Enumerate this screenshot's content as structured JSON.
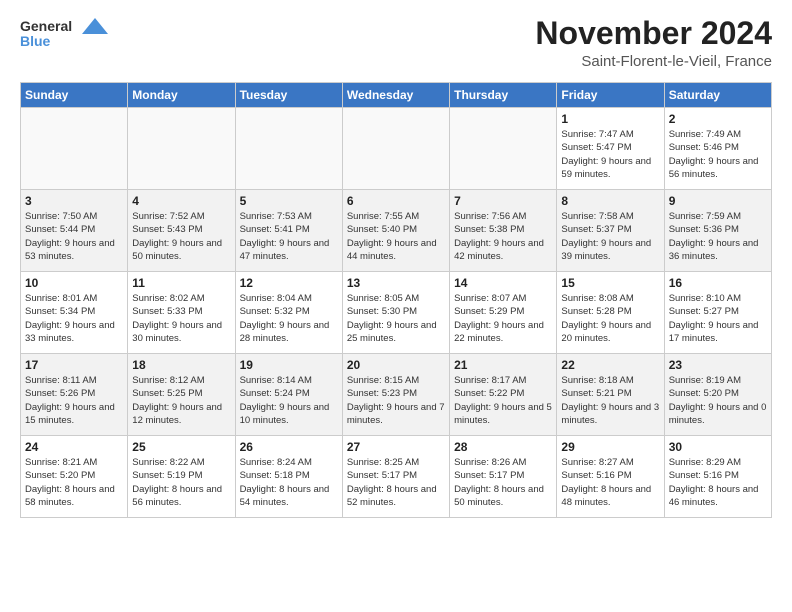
{
  "logo": {
    "text_general": "General",
    "text_blue": "Blue"
  },
  "title": "November 2024",
  "subtitle": "Saint-Florent-le-Vieil, France",
  "days_of_week": [
    "Sunday",
    "Monday",
    "Tuesday",
    "Wednesday",
    "Thursday",
    "Friday",
    "Saturday"
  ],
  "weeks": [
    [
      {
        "day": "",
        "info": ""
      },
      {
        "day": "",
        "info": ""
      },
      {
        "day": "",
        "info": ""
      },
      {
        "day": "",
        "info": ""
      },
      {
        "day": "",
        "info": ""
      },
      {
        "day": "1",
        "info": "Sunrise: 7:47 AM\nSunset: 5:47 PM\nDaylight: 9 hours and 59 minutes."
      },
      {
        "day": "2",
        "info": "Sunrise: 7:49 AM\nSunset: 5:46 PM\nDaylight: 9 hours and 56 minutes."
      }
    ],
    [
      {
        "day": "3",
        "info": "Sunrise: 7:50 AM\nSunset: 5:44 PM\nDaylight: 9 hours and 53 minutes."
      },
      {
        "day": "4",
        "info": "Sunrise: 7:52 AM\nSunset: 5:43 PM\nDaylight: 9 hours and 50 minutes."
      },
      {
        "day": "5",
        "info": "Sunrise: 7:53 AM\nSunset: 5:41 PM\nDaylight: 9 hours and 47 minutes."
      },
      {
        "day": "6",
        "info": "Sunrise: 7:55 AM\nSunset: 5:40 PM\nDaylight: 9 hours and 44 minutes."
      },
      {
        "day": "7",
        "info": "Sunrise: 7:56 AM\nSunset: 5:38 PM\nDaylight: 9 hours and 42 minutes."
      },
      {
        "day": "8",
        "info": "Sunrise: 7:58 AM\nSunset: 5:37 PM\nDaylight: 9 hours and 39 minutes."
      },
      {
        "day": "9",
        "info": "Sunrise: 7:59 AM\nSunset: 5:36 PM\nDaylight: 9 hours and 36 minutes."
      }
    ],
    [
      {
        "day": "10",
        "info": "Sunrise: 8:01 AM\nSunset: 5:34 PM\nDaylight: 9 hours and 33 minutes."
      },
      {
        "day": "11",
        "info": "Sunrise: 8:02 AM\nSunset: 5:33 PM\nDaylight: 9 hours and 30 minutes."
      },
      {
        "day": "12",
        "info": "Sunrise: 8:04 AM\nSunset: 5:32 PM\nDaylight: 9 hours and 28 minutes."
      },
      {
        "day": "13",
        "info": "Sunrise: 8:05 AM\nSunset: 5:30 PM\nDaylight: 9 hours and 25 minutes."
      },
      {
        "day": "14",
        "info": "Sunrise: 8:07 AM\nSunset: 5:29 PM\nDaylight: 9 hours and 22 minutes."
      },
      {
        "day": "15",
        "info": "Sunrise: 8:08 AM\nSunset: 5:28 PM\nDaylight: 9 hours and 20 minutes."
      },
      {
        "day": "16",
        "info": "Sunrise: 8:10 AM\nSunset: 5:27 PM\nDaylight: 9 hours and 17 minutes."
      }
    ],
    [
      {
        "day": "17",
        "info": "Sunrise: 8:11 AM\nSunset: 5:26 PM\nDaylight: 9 hours and 15 minutes."
      },
      {
        "day": "18",
        "info": "Sunrise: 8:12 AM\nSunset: 5:25 PM\nDaylight: 9 hours and 12 minutes."
      },
      {
        "day": "19",
        "info": "Sunrise: 8:14 AM\nSunset: 5:24 PM\nDaylight: 9 hours and 10 minutes."
      },
      {
        "day": "20",
        "info": "Sunrise: 8:15 AM\nSunset: 5:23 PM\nDaylight: 9 hours and 7 minutes."
      },
      {
        "day": "21",
        "info": "Sunrise: 8:17 AM\nSunset: 5:22 PM\nDaylight: 9 hours and 5 minutes."
      },
      {
        "day": "22",
        "info": "Sunrise: 8:18 AM\nSunset: 5:21 PM\nDaylight: 9 hours and 3 minutes."
      },
      {
        "day": "23",
        "info": "Sunrise: 8:19 AM\nSunset: 5:20 PM\nDaylight: 9 hours and 0 minutes."
      }
    ],
    [
      {
        "day": "24",
        "info": "Sunrise: 8:21 AM\nSunset: 5:20 PM\nDaylight: 8 hours and 58 minutes."
      },
      {
        "day": "25",
        "info": "Sunrise: 8:22 AM\nSunset: 5:19 PM\nDaylight: 8 hours and 56 minutes."
      },
      {
        "day": "26",
        "info": "Sunrise: 8:24 AM\nSunset: 5:18 PM\nDaylight: 8 hours and 54 minutes."
      },
      {
        "day": "27",
        "info": "Sunrise: 8:25 AM\nSunset: 5:17 PM\nDaylight: 8 hours and 52 minutes."
      },
      {
        "day": "28",
        "info": "Sunrise: 8:26 AM\nSunset: 5:17 PM\nDaylight: 8 hours and 50 minutes."
      },
      {
        "day": "29",
        "info": "Sunrise: 8:27 AM\nSunset: 5:16 PM\nDaylight: 8 hours and 48 minutes."
      },
      {
        "day": "30",
        "info": "Sunrise: 8:29 AM\nSunset: 5:16 PM\nDaylight: 8 hours and 46 minutes."
      }
    ]
  ]
}
